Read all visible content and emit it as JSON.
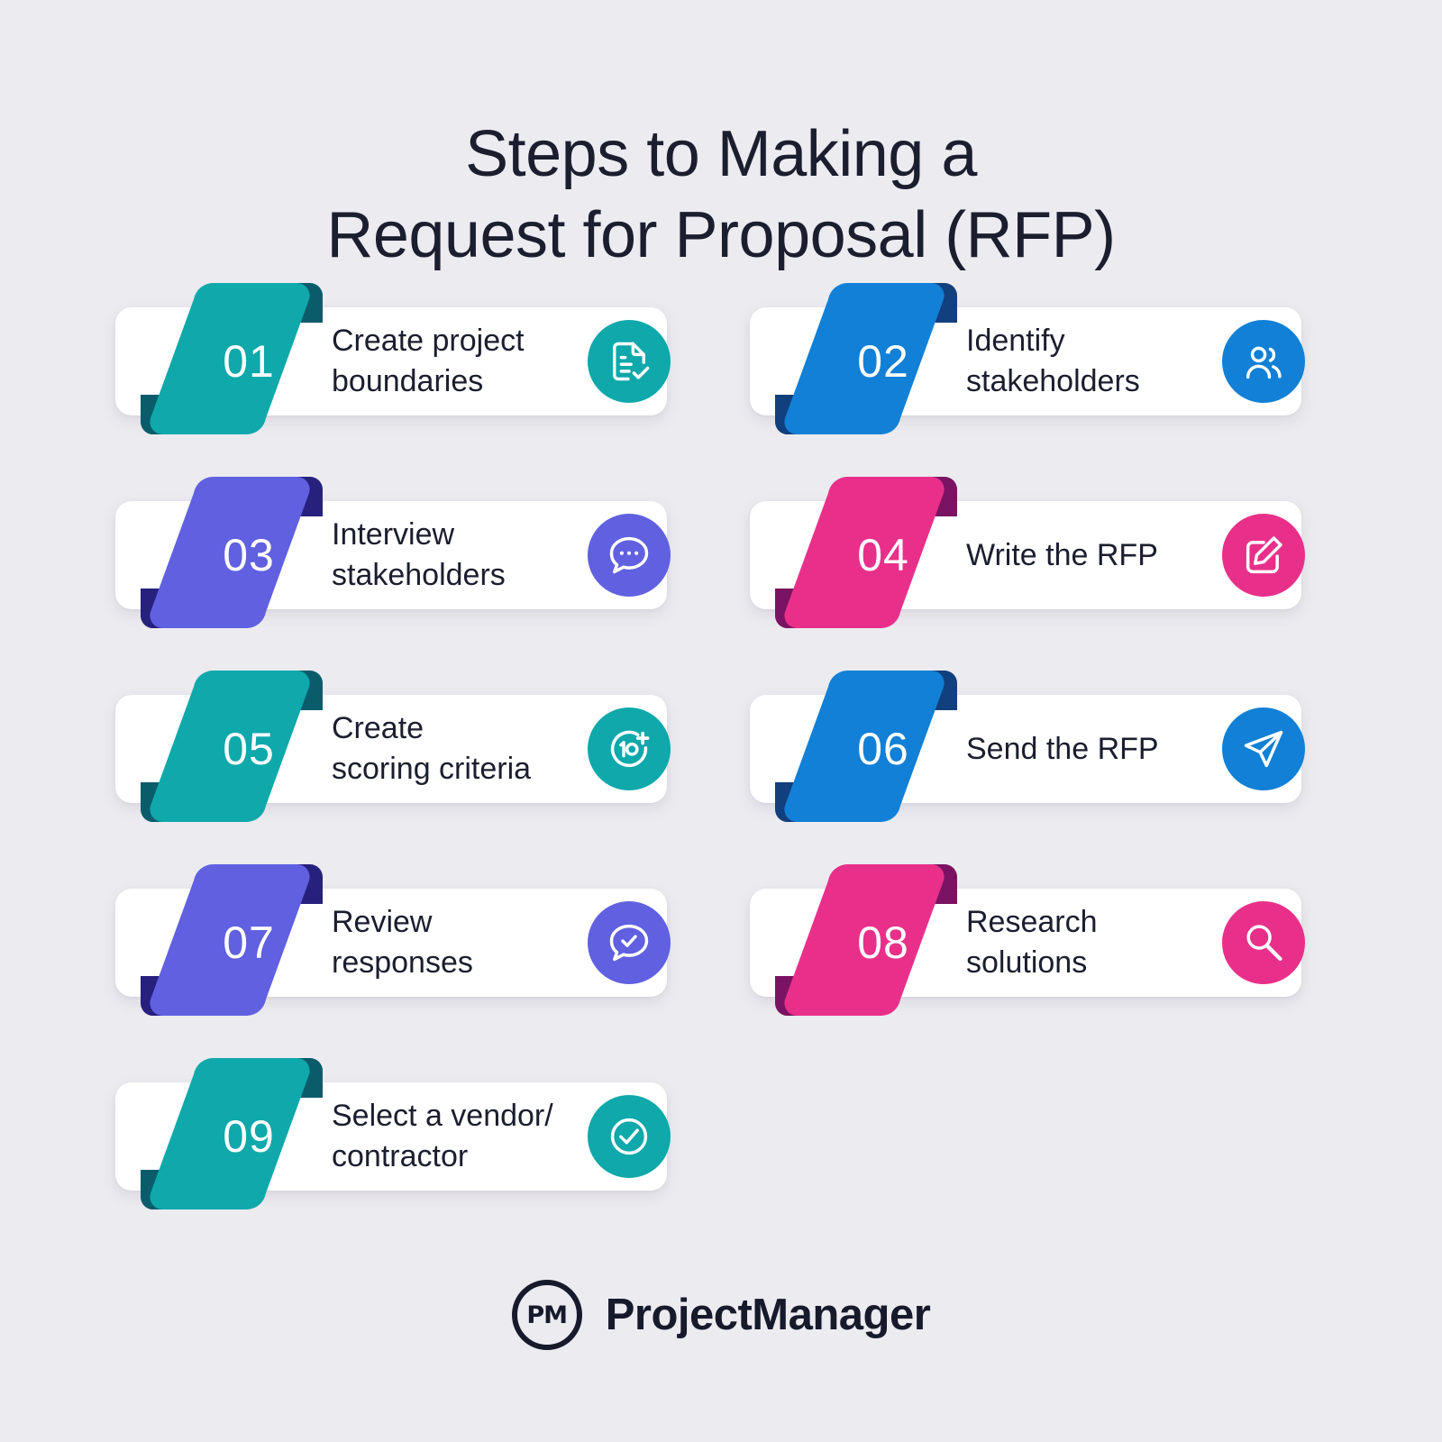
{
  "title": "Steps to Making a\nRequest for Proposal (RFP)",
  "palette": {
    "background": "#ECEBF0",
    "card": "#FFFFFF",
    "text": "#1B1E2E",
    "teal": "#0FA8AB",
    "teal_fold": "#0A5C6B",
    "blue": "#1180D6",
    "blue_fold": "#123F7D",
    "purple": "#6060E0",
    "purple_fold": "#27217E",
    "pink": "#E8308A",
    "pink_fold": "#7A1361"
  },
  "steps": [
    {
      "number": "01",
      "label": "Create project\nboundaries",
      "color": "#0FA8AB",
      "fold": "#0A5C6B",
      "icon": "document-check-icon"
    },
    {
      "number": "02",
      "label": "Identify\nstakeholders",
      "color": "#1180D6",
      "fold": "#123F7D",
      "icon": "users-icon"
    },
    {
      "number": "03",
      "label": "Interview\nstakeholders",
      "color": "#6060E0",
      "fold": "#27217E",
      "icon": "chat-dots-icon"
    },
    {
      "number": "04",
      "label": "Write the RFP",
      "color": "#E8308A",
      "fold": "#7A1361",
      "icon": "edit-square-icon"
    },
    {
      "number": "05",
      "label": "Create\nscoring criteria",
      "color": "#0FA8AB",
      "fold": "#0A5C6B",
      "icon": "score-ten-plus-icon"
    },
    {
      "number": "06",
      "label": "Send the RFP",
      "color": "#1180D6",
      "fold": "#123F7D",
      "icon": "paper-plane-icon"
    },
    {
      "number": "07",
      "label": "Review\nresponses",
      "color": "#6060E0",
      "fold": "#27217E",
      "icon": "chat-check-icon"
    },
    {
      "number": "08",
      "label": "Research\nsolutions",
      "color": "#E8308A",
      "fold": "#7A1361",
      "icon": "magnifier-icon"
    },
    {
      "number": "09",
      "label": "Select a vendor/\ncontractor",
      "color": "#0FA8AB",
      "fold": "#0A5C6B",
      "icon": "check-circle-icon"
    }
  ],
  "logo": {
    "mark": "PM",
    "name": "ProjectManager"
  }
}
